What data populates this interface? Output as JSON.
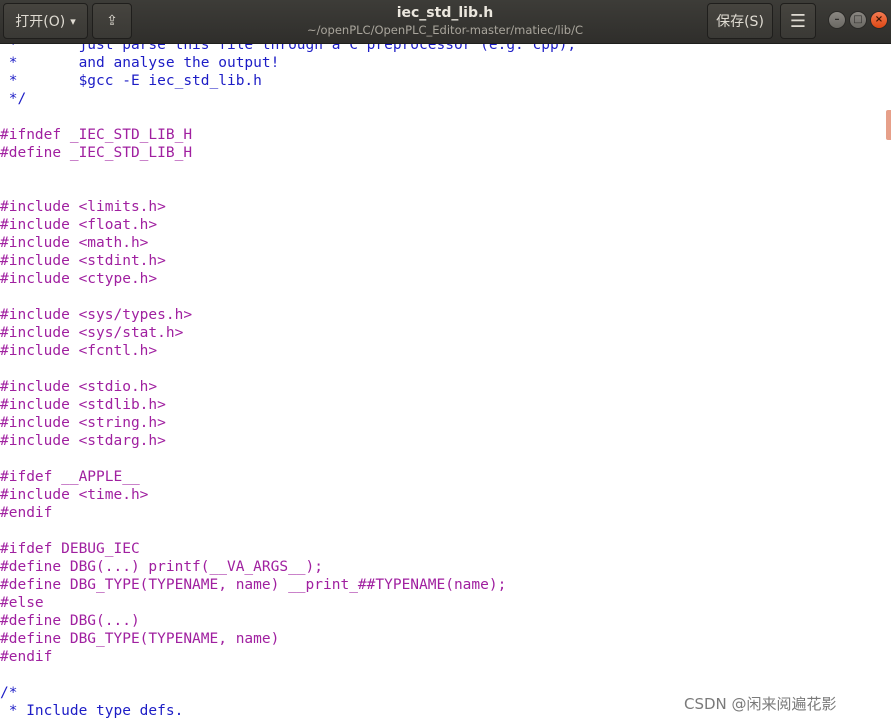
{
  "toolbar": {
    "open_label": "打开(O)",
    "open_caret": "▾",
    "pin_icon": "⇪",
    "save_label": "保存(S)",
    "menu_icon": "☰"
  },
  "title": {
    "filename": "iec_std_lib.h",
    "path": "~/openPLC/OpenPLC_Editor-master/matiec/lib/C"
  },
  "window_controls": {
    "minimize": "–",
    "maximize": "□",
    "close": "×"
  },
  "code_lines": [
    {
      "t": " *       just parse this file through a C preprocessor (e.g. cpp),",
      "k": "comment"
    },
    {
      "t": " *       and analyse the output!",
      "k": "comment"
    },
    {
      "t": " *       $gcc -E iec_std_lib.h",
      "k": "comment"
    },
    {
      "t": " */",
      "k": "comment"
    },
    {
      "t": "",
      "k": "plain"
    },
    {
      "t": "#ifndef _IEC_STD_LIB_H",
      "k": "pp"
    },
    {
      "t": "#define _IEC_STD_LIB_H",
      "k": "pp"
    },
    {
      "t": "",
      "k": "plain"
    },
    {
      "t": "",
      "k": "plain"
    },
    {
      "t": "#include <limits.h>",
      "k": "pp"
    },
    {
      "t": "#include <float.h>",
      "k": "pp"
    },
    {
      "t": "#include <math.h>",
      "k": "pp"
    },
    {
      "t": "#include <stdint.h>",
      "k": "pp"
    },
    {
      "t": "#include <ctype.h>",
      "k": "pp"
    },
    {
      "t": "",
      "k": "plain"
    },
    {
      "t": "#include <sys/types.h>",
      "k": "pp"
    },
    {
      "t": "#include <sys/stat.h>",
      "k": "pp"
    },
    {
      "t": "#include <fcntl.h>",
      "k": "pp"
    },
    {
      "t": "",
      "k": "plain"
    },
    {
      "t": "#include <stdio.h>",
      "k": "pp"
    },
    {
      "t": "#include <stdlib.h>",
      "k": "pp"
    },
    {
      "t": "#include <string.h>",
      "k": "pp"
    },
    {
      "t": "#include <stdarg.h>",
      "k": "pp"
    },
    {
      "t": "",
      "k": "plain"
    },
    {
      "t": "#ifdef __APPLE__",
      "k": "pp"
    },
    {
      "t": "#include <time.h>",
      "k": "pp"
    },
    {
      "t": "#endif",
      "k": "pp"
    },
    {
      "t": "",
      "k": "plain"
    },
    {
      "t": "#ifdef DEBUG_IEC",
      "k": "pp"
    },
    {
      "t": "#define DBG(...) printf(__VA_ARGS__);",
      "k": "pp"
    },
    {
      "t": "#define DBG_TYPE(TYPENAME, name) __print_##TYPENAME(name);",
      "k": "pp"
    },
    {
      "t": "#else",
      "k": "pp"
    },
    {
      "t": "#define DBG(...)",
      "k": "pp"
    },
    {
      "t": "#define DBG_TYPE(TYPENAME, name)",
      "k": "pp"
    },
    {
      "t": "#endif",
      "k": "pp"
    },
    {
      "t": "",
      "k": "plain"
    },
    {
      "t": "/*",
      "k": "comment"
    },
    {
      "t": " * Include type defs.",
      "k": "comment"
    }
  ],
  "watermark": "CSDN @闲来阅遍花影",
  "colors": {
    "comment": "#1d1dc6",
    "preprocessor": "#a020a0",
    "titlebar": "#3d3c38",
    "close_button": "#dd4814"
  }
}
